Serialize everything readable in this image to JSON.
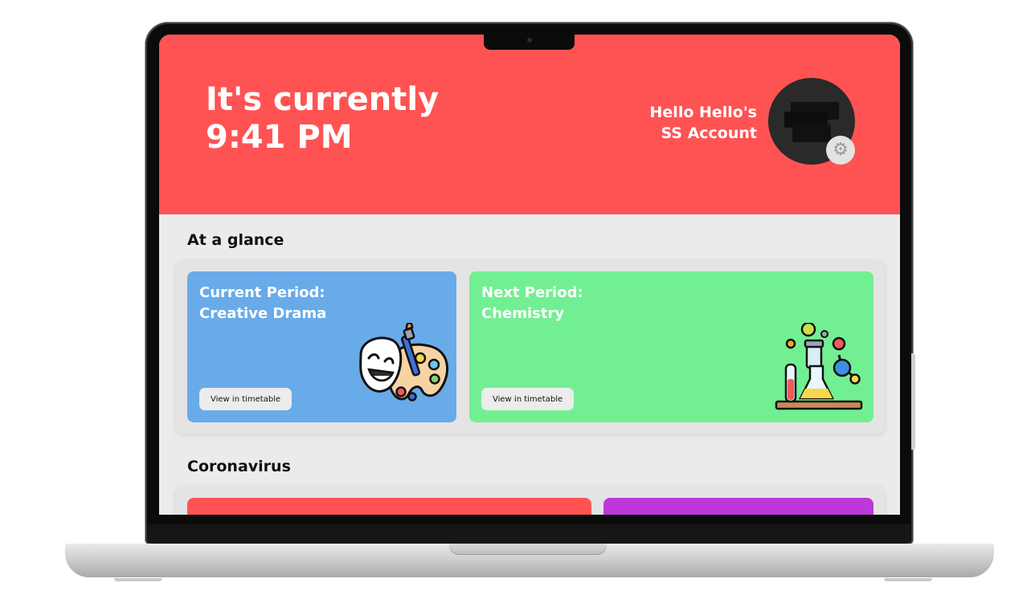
{
  "header": {
    "time_line1": "It's currently",
    "time_line2": "9:41 PM",
    "account_line1": "Hello Hello's",
    "account_line2": "SS Account",
    "settings_icon": "gear-icon"
  },
  "glance": {
    "title": "At a glance",
    "current": {
      "line1": "Current Period:",
      "line2": "Creative Drama",
      "button": "View in timetable",
      "color": "#68abe8",
      "icon": "drama-masks-palette-icon"
    },
    "next": {
      "line1": "Next Period:",
      "line2": "Chemistry",
      "button": "View in timetable",
      "color": "#72ef93",
      "icon": "chemistry-lab-icon"
    }
  },
  "coronavirus": {
    "title": "Coronavirus",
    "card_colors": [
      "#ff5353",
      "#be37d9"
    ]
  },
  "colors": {
    "header_bg": "#ff5353",
    "page_bg": "#ebebeb"
  }
}
